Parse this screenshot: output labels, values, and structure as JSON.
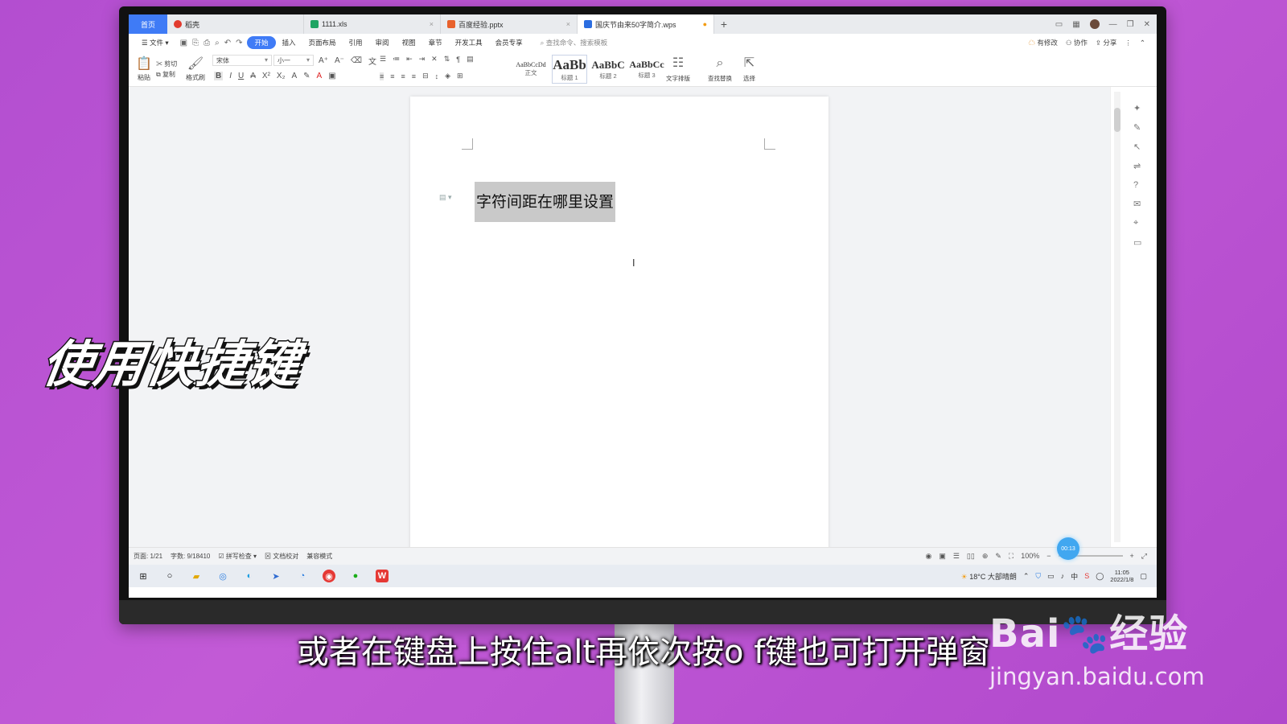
{
  "overlay": {
    "title": "使用快捷键",
    "caption": "或者在键盘上按住alt再依次按o f键也可打开弹窗",
    "watermark_logo_a": "Bai",
    "watermark_logo_b": "经验",
    "watermark_url": "jingyan.baidu.com"
  },
  "tabs": {
    "home": "首页",
    "items": [
      {
        "label": "稻壳",
        "color": "#e23b2e"
      },
      {
        "label": "1111.xls",
        "color": "#1fa463"
      },
      {
        "label": "百度经验.pptx",
        "color": "#e8612c"
      },
      {
        "label": "国庆节由来50字简介.wps",
        "color": "#2b6de0"
      }
    ],
    "new_tab": "+"
  },
  "menu": {
    "file": "文件",
    "items": [
      "开始",
      "插入",
      "页面布局",
      "引用",
      "审阅",
      "视图",
      "章节",
      "开发工具",
      "会员专享"
    ],
    "search": "查找命令、搜索模板",
    "right": [
      "有修改",
      "协作",
      "分享"
    ]
  },
  "ribbon": {
    "paste": "粘贴",
    "cut": "剪切",
    "copy": "复制",
    "format_painter": "格式刷",
    "font_name": "宋体",
    "font_size": "小一",
    "styles": [
      {
        "preview": "AaBbCcDd",
        "name": "正文"
      },
      {
        "preview": "AaBb",
        "name": "标题 1"
      },
      {
        "preview": "AaBbC",
        "name": "标题 2"
      },
      {
        "preview": "AaBbCc",
        "name": "标题 3"
      }
    ],
    "text_layout": "文字排版",
    "find_replace": "查找替换",
    "select": "选择"
  },
  "document": {
    "heading": "字符间距在哪里设置"
  },
  "status": {
    "page": "页面: 1/21",
    "words": "字数: 9/18410",
    "spell": "拼写检查",
    "proof": "文档校对",
    "compat": "兼容模式",
    "zoom": "100%",
    "timer": "00:13"
  },
  "tray": {
    "weather": "18°C 大部晴朗",
    "time": "11:05",
    "date": "2022/1/8"
  }
}
